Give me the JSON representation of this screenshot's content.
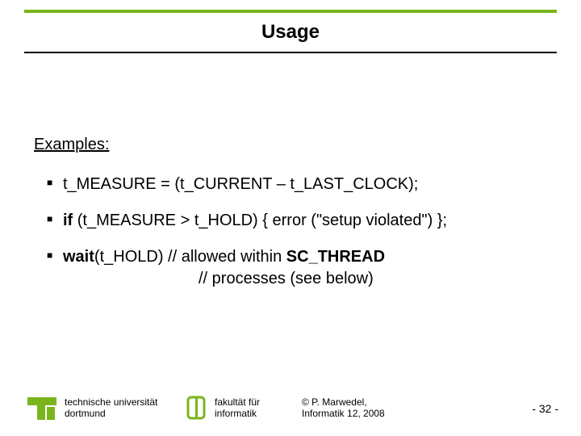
{
  "title": "Usage",
  "examples_label": "Examples:",
  "bullets": {
    "b0": "t_MEASURE = (t_CURRENT – t_LAST_CLOCK);",
    "b1": "if (t_MEASURE > t_HOLD) { error (\"setup violated\") };",
    "b2a": "wait(t_HOLD) // allowed within SC_THREAD",
    "b2b": "// processes (see below)"
  },
  "footer": {
    "university": {
      "line1": "technische universität",
      "line2": "dortmund"
    },
    "faculty": {
      "line1": "fakultät für",
      "line2": "informatik"
    },
    "copyright": {
      "line1": "© P. Marwedel,",
      "line2": "Informatik 12,  2008"
    },
    "page": "-  32 -"
  },
  "colors": {
    "accent": "#7ab51d"
  }
}
